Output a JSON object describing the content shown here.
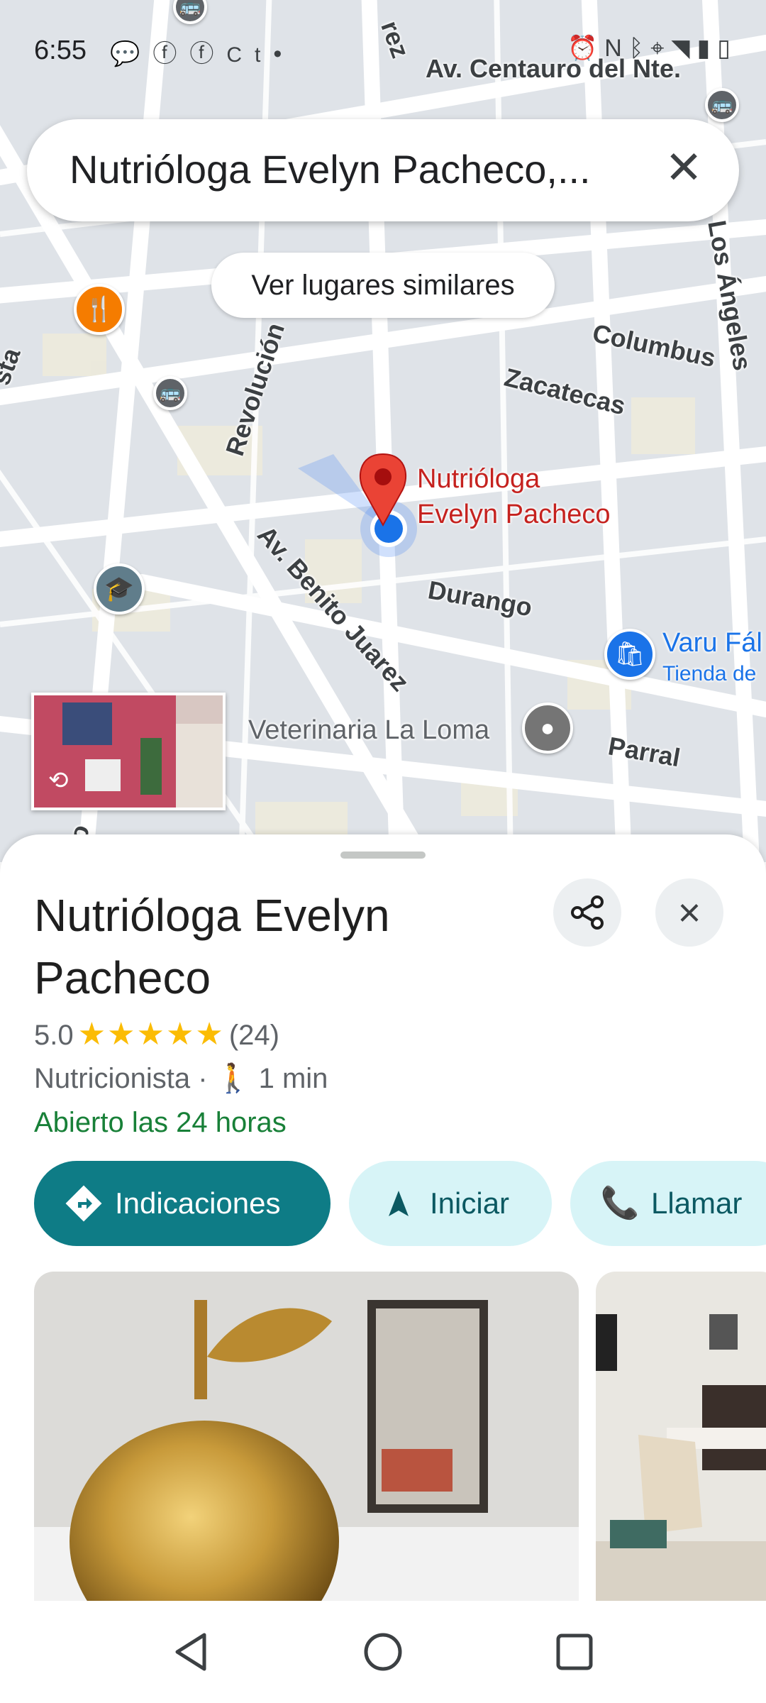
{
  "status_bar": {
    "time": "6:55",
    "left_icons": [
      "messenger-icon",
      "facebook-icon",
      "facebook-icon",
      "ct-icon",
      "dot-icon"
    ],
    "right_icons": [
      "alarm-icon",
      "nfc-icon",
      "bluetooth-icon",
      "location-icon",
      "data-icon",
      "wifi-icon",
      "signal-icon",
      "battery-icon"
    ]
  },
  "search": {
    "query": "Nutrióloga Evelyn Pacheco,...",
    "clear_icon": "close-icon"
  },
  "map": {
    "similar_button": "Ver lugares similares",
    "pin_label_line1": "Nutrióloga",
    "pin_label_line2": "Evelyn Pacheco",
    "streets": {
      "centauro": "Av. Centauro del Nte.",
      "columbus": "Columbus",
      "zacatecas": "Zacatecas",
      "revolucion": "Revolución",
      "benito_juarez": "Av. Benito Juarez",
      "durango": "Durango",
      "parral": "Parral",
      "angeles": "Los Ángeles",
      "ez": "rez",
      "sta": "sta",
      "rro": "rro"
    },
    "vet_label": "Veterinaria La Loma",
    "varu_label_line1": "Varu Fál",
    "varu_label_line2": "Tienda de"
  },
  "place": {
    "name": "Nutrióloga Evelyn Pacheco",
    "rating": "5.0",
    "stars": "★★★★★",
    "reviews": "(24)",
    "category": "Nutricionista",
    "separator": "·",
    "walk_time": "1 min",
    "hours_status": "Abierto las 24 horas",
    "colors": {
      "open": "#188038",
      "primary_chip": "#0e7c86",
      "secondary_chip": "#d7f4f7",
      "stars": "#fbbc04",
      "pin": "#ea4335"
    }
  },
  "actions": {
    "directions": "Indicaciones",
    "start": "Iniciar",
    "call": "Llamar"
  }
}
